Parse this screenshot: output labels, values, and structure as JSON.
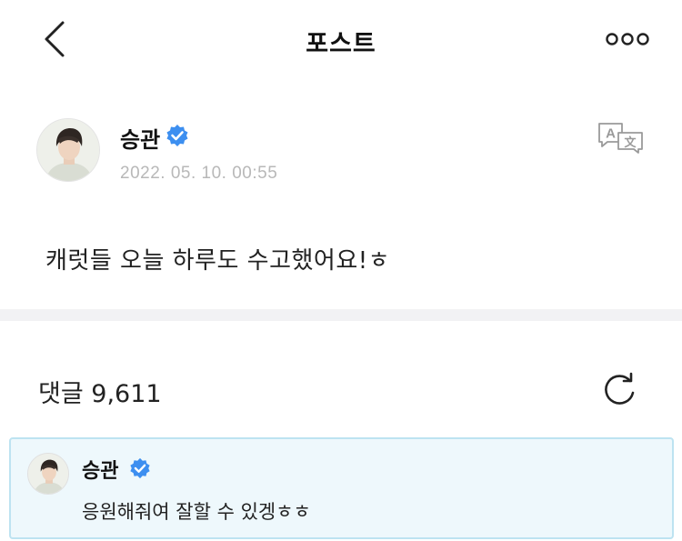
{
  "header": {
    "title": "포스트",
    "back_icon": "chevron-left-icon",
    "more_icon": "more-dots-icon"
  },
  "post": {
    "author": "승관",
    "date": "2022. 05. 10. 00:55",
    "body": "캐럿들 오늘 하루도 수고했어요!ㅎ",
    "verified_icon": "verified-badge-icon",
    "translate_icon": "translate-icon"
  },
  "comments": {
    "label": "댓글 9,611",
    "refresh_icon": "refresh-icon",
    "items": [
      {
        "author": "승관",
        "text": "응원해줘여 잘할 수 있겡ㅎㅎ"
      }
    ]
  },
  "colors": {
    "verified": "#3d8ff0",
    "date_text": "#b8b8b8",
    "comment_bg": "#eef8fc",
    "comment_border": "#bde3f1",
    "divider": "#f2f2f4"
  }
}
